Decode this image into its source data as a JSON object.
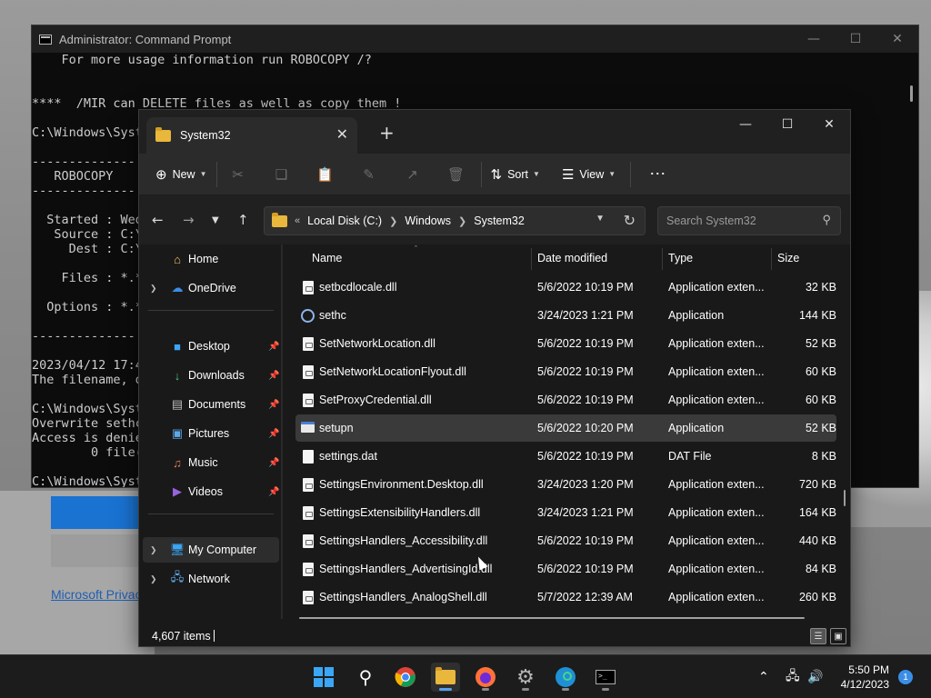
{
  "desktop": {
    "link_text": "Microsoft Privacy"
  },
  "cmd": {
    "title": "Administrator: Command Prompt",
    "lines": [
      "    For more usage information run ROBOCOPY /?",
      "",
      "",
      "****  /MIR can DELETE files as well as copy them !",
      "",
      "C:\\Windows\\Syst",
      "",
      "--------------",
      "   ROBOCOPY",
      "--------------",
      "",
      "  Started : Wed",
      "   Source : C:\\",
      "     Dest : C:\\",
      "",
      "    Files : *.*",
      "",
      "  Options : *.*",
      "",
      "--------------",
      "",
      "2023/04/12 17:4",
      "The filename, d",
      "",
      "C:\\Windows\\Syst",
      "Overwrite sethc",
      "Access is denie",
      "        0 file(",
      "",
      "C:\\Windows\\Syst"
    ]
  },
  "explorer": {
    "tab_title": "System32",
    "toolbar": {
      "new_label": "New",
      "sort_label": "Sort",
      "view_label": "View"
    },
    "address": {
      "prefix": "«",
      "crumbs": [
        "Local Disk (C:)",
        "Windows",
        "System32"
      ]
    },
    "search_placeholder": "Search System32",
    "nav": {
      "home": "Home",
      "onedrive": "OneDrive",
      "desktop": "Desktop",
      "downloads": "Downloads",
      "documents": "Documents",
      "pictures": "Pictures",
      "music": "Music",
      "videos": "Videos",
      "my_computer": "My Computer",
      "network": "Network"
    },
    "columns": {
      "name": "Name",
      "date": "Date modified",
      "type": "Type",
      "size": "Size"
    },
    "files": [
      {
        "name": "setbcdlocale.dll",
        "date": "5/6/2022 10:19 PM",
        "type": "Application exten...",
        "size": "32 KB",
        "icon": "dll-file-icon"
      },
      {
        "name": "sethc",
        "date": "3/24/2023 1:21 PM",
        "type": "Application",
        "size": "144 KB",
        "icon": "accessibility-app-icon"
      },
      {
        "name": "SetNetworkLocation.dll",
        "date": "5/6/2022 10:19 PM",
        "type": "Application exten...",
        "size": "52 KB",
        "icon": "dll-file-icon"
      },
      {
        "name": "SetNetworkLocationFlyout.dll",
        "date": "5/6/2022 10:19 PM",
        "type": "Application exten...",
        "size": "60 KB",
        "icon": "dll-file-icon"
      },
      {
        "name": "SetProxyCredential.dll",
        "date": "5/6/2022 10:19 PM",
        "type": "Application exten...",
        "size": "60 KB",
        "icon": "dll-file-icon"
      },
      {
        "name": "setupn",
        "date": "5/6/2022 10:20 PM",
        "type": "Application",
        "size": "52 KB",
        "icon": "app-window-icon"
      },
      {
        "name": "settings.dat",
        "date": "5/6/2022 10:19 PM",
        "type": "DAT File",
        "size": "8 KB",
        "icon": "dat-file-icon"
      },
      {
        "name": "SettingsEnvironment.Desktop.dll",
        "date": "3/24/2023 1:20 PM",
        "type": "Application exten...",
        "size": "720 KB",
        "icon": "dll-file-icon"
      },
      {
        "name": "SettingsExtensibilityHandlers.dll",
        "date": "3/24/2023 1:21 PM",
        "type": "Application exten...",
        "size": "164 KB",
        "icon": "dll-file-icon"
      },
      {
        "name": "SettingsHandlers_Accessibility.dll",
        "date": "5/6/2022 10:19 PM",
        "type": "Application exten...",
        "size": "440 KB",
        "icon": "dll-file-icon"
      },
      {
        "name": "SettingsHandlers_AdvertisingId.dll",
        "date": "5/6/2022 10:19 PM",
        "type": "Application exten...",
        "size": "84 KB",
        "icon": "dll-file-icon"
      },
      {
        "name": "SettingsHandlers_AnalogShell.dll",
        "date": "5/7/2022 12:39 AM",
        "type": "Application exten...",
        "size": "260 KB",
        "icon": "dll-file-icon"
      }
    ],
    "status": {
      "item_count": "4,607 items"
    }
  },
  "taskbar": {
    "time": "5:50 PM",
    "date": "4/12/2023",
    "notification_count": "1",
    "apps": [
      "start-icon",
      "search-icon",
      "chrome-icon",
      "file-explorer-icon",
      "firefox-icon",
      "settings-icon",
      "edge-icon",
      "terminal-icon"
    ]
  },
  "colors": {
    "accent": "#3aa6f5",
    "folder": "#e9b73c",
    "explorer_bg": "#191919",
    "cmd_bg": "#0c0c0c"
  }
}
